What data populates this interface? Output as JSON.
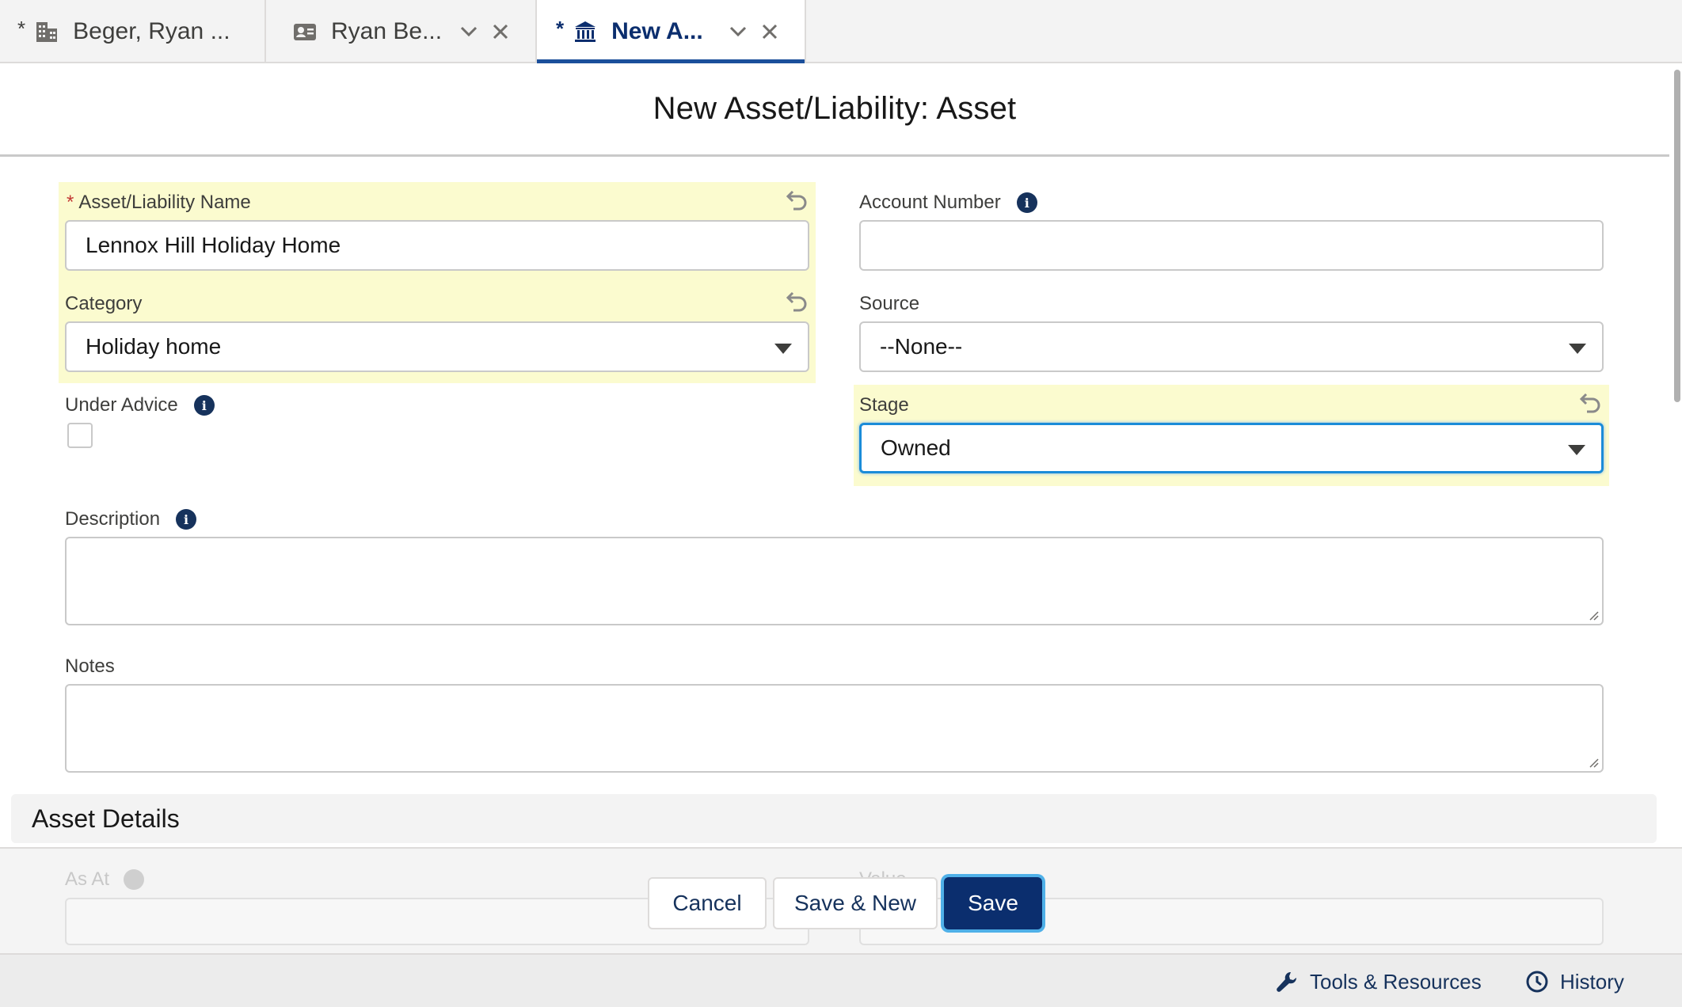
{
  "tabs": [
    {
      "dirty": "*",
      "label": "Beger, Ryan ...",
      "icon": "building-icon"
    },
    {
      "dirty": "",
      "label": "Ryan Be...",
      "icon": "contact-card-icon"
    },
    {
      "dirty": "*",
      "label": "New A...",
      "icon": "bank-icon",
      "active": true
    }
  ],
  "modal": {
    "title": "New Asset/Liability: Asset"
  },
  "form": {
    "name": {
      "required_mark": "*",
      "label": "Asset/Liability Name",
      "value": "Lennox Hill Holiday Home"
    },
    "account_number": {
      "label": "Account Number",
      "value": ""
    },
    "category": {
      "label": "Category",
      "value": "Holiday home"
    },
    "source": {
      "label": "Source",
      "value": "--None--"
    },
    "under_advice": {
      "label": "Under Advice",
      "checked": false
    },
    "stage": {
      "label": "Stage",
      "value": "Owned"
    },
    "description": {
      "label": "Description",
      "value": ""
    },
    "notes": {
      "label": "Notes",
      "value": ""
    }
  },
  "section": {
    "title": "Asset Details"
  },
  "asset_details": {
    "as_at_label": "As At",
    "value_label": "Value"
  },
  "footer": {
    "cancel": "Cancel",
    "save_new": "Save & New",
    "save": "Save"
  },
  "utility": {
    "tools": "Tools & Resources",
    "history": "History"
  },
  "colors": {
    "highlight": "#fbfbcf",
    "brand": "#0b2e6e",
    "focus": "#1b8cd8",
    "info": "#16325c"
  }
}
